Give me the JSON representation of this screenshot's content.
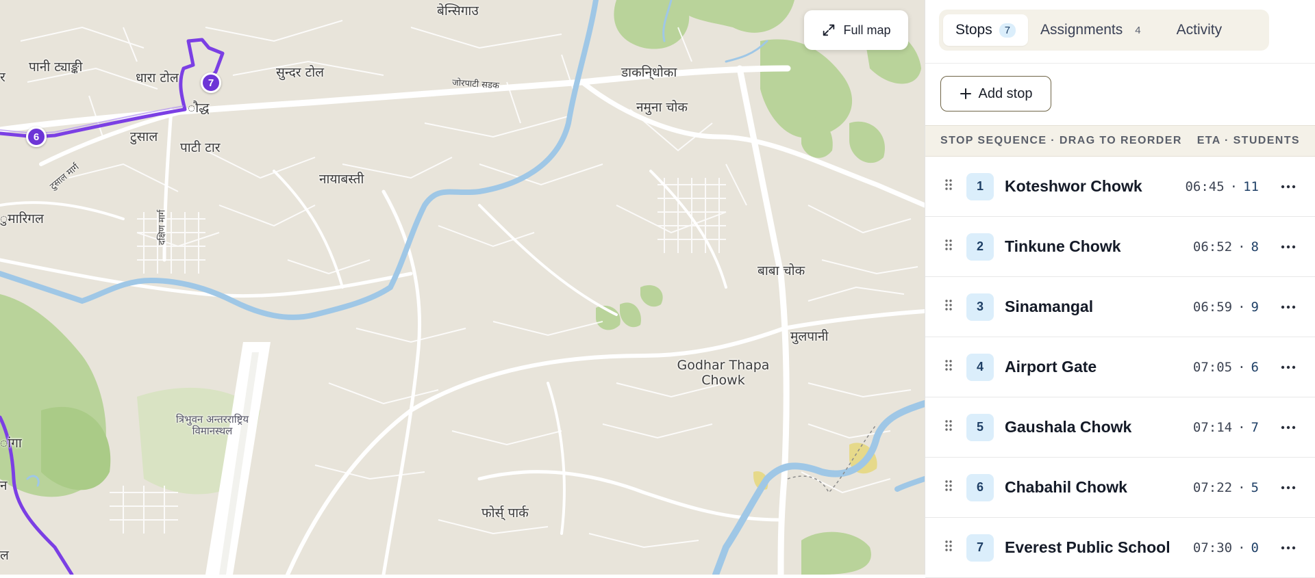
{
  "map": {
    "full_map_label": "Full map",
    "route_markers": [
      {
        "number": "6"
      },
      {
        "number": "7"
      }
    ],
    "labels": {
      "pani_tyanki": "पानी ट्याङ्की",
      "dhara_tol": "धारा टोल",
      "buddha": "ौद्ध",
      "tusal": "टुसाल",
      "pati_tar": "पाटी टार",
      "sundar_tol": "सुन्दर टोल",
      "bensigaun": "बेन्सिगाउ",
      "jorpati_road": "जोरपाटी सडक",
      "dakanidhoka": "डाकनि्धोका",
      "namuna_chowk": "नमुना चोक",
      "nayabasti": "नायाबस्ती",
      "kumarigal": "ुमारिगल",
      "r_edge": "र",
      "dakshin_marg": "दक्षिण मार्ग",
      "tusal_marg": "टुसाल मार्ग",
      "baba_chowk": "बाबा चोक",
      "mulpani": "मुलपानी",
      "godhar_thapa": "Godhar Thapa",
      "godhar_chowk": "Chowk",
      "airport_1": "त्रिभुवन अन्तरराष्ट्रिय",
      "airport_2": "विमानस्थल",
      "forest_park": "फोर्स् पार्क",
      "ga_edge": "ांगा",
      "na_edge": "न",
      "la_edge": "ल"
    }
  },
  "tabs": [
    {
      "label": "Stops",
      "count": "7",
      "active": true
    },
    {
      "label": "Assignments",
      "count": "4",
      "active": false
    },
    {
      "label": "Activity",
      "count": "",
      "active": false
    }
  ],
  "add_stop_label": "Add stop",
  "sequence_header": {
    "left": "STOP SEQUENCE · DRAG TO REORDER",
    "right": "ETA · STUDENTS"
  },
  "stops": [
    {
      "num": "1",
      "name": "Koteshwor Chowk",
      "eta": "06:45",
      "students": "11"
    },
    {
      "num": "2",
      "name": "Tinkune Chowk",
      "eta": "06:52",
      "students": "8"
    },
    {
      "num": "3",
      "name": "Sinamangal",
      "eta": "06:59",
      "students": "9"
    },
    {
      "num": "4",
      "name": "Airport Gate",
      "eta": "07:05",
      "students": "6"
    },
    {
      "num": "5",
      "name": "Gaushala Chowk",
      "eta": "07:14",
      "students": "7"
    },
    {
      "num": "6",
      "name": "Chabahil Chowk",
      "eta": "07:22",
      "students": "5"
    },
    {
      "num": "7",
      "name": "Everest Public School",
      "eta": "07:30",
      "students": "0"
    }
  ],
  "colors": {
    "route": "#7b3fe4",
    "river": "#9fc7e6",
    "park": "#b9d39a",
    "map_bg": "#e8e4da",
    "badge_bg": "#dbeefb"
  }
}
